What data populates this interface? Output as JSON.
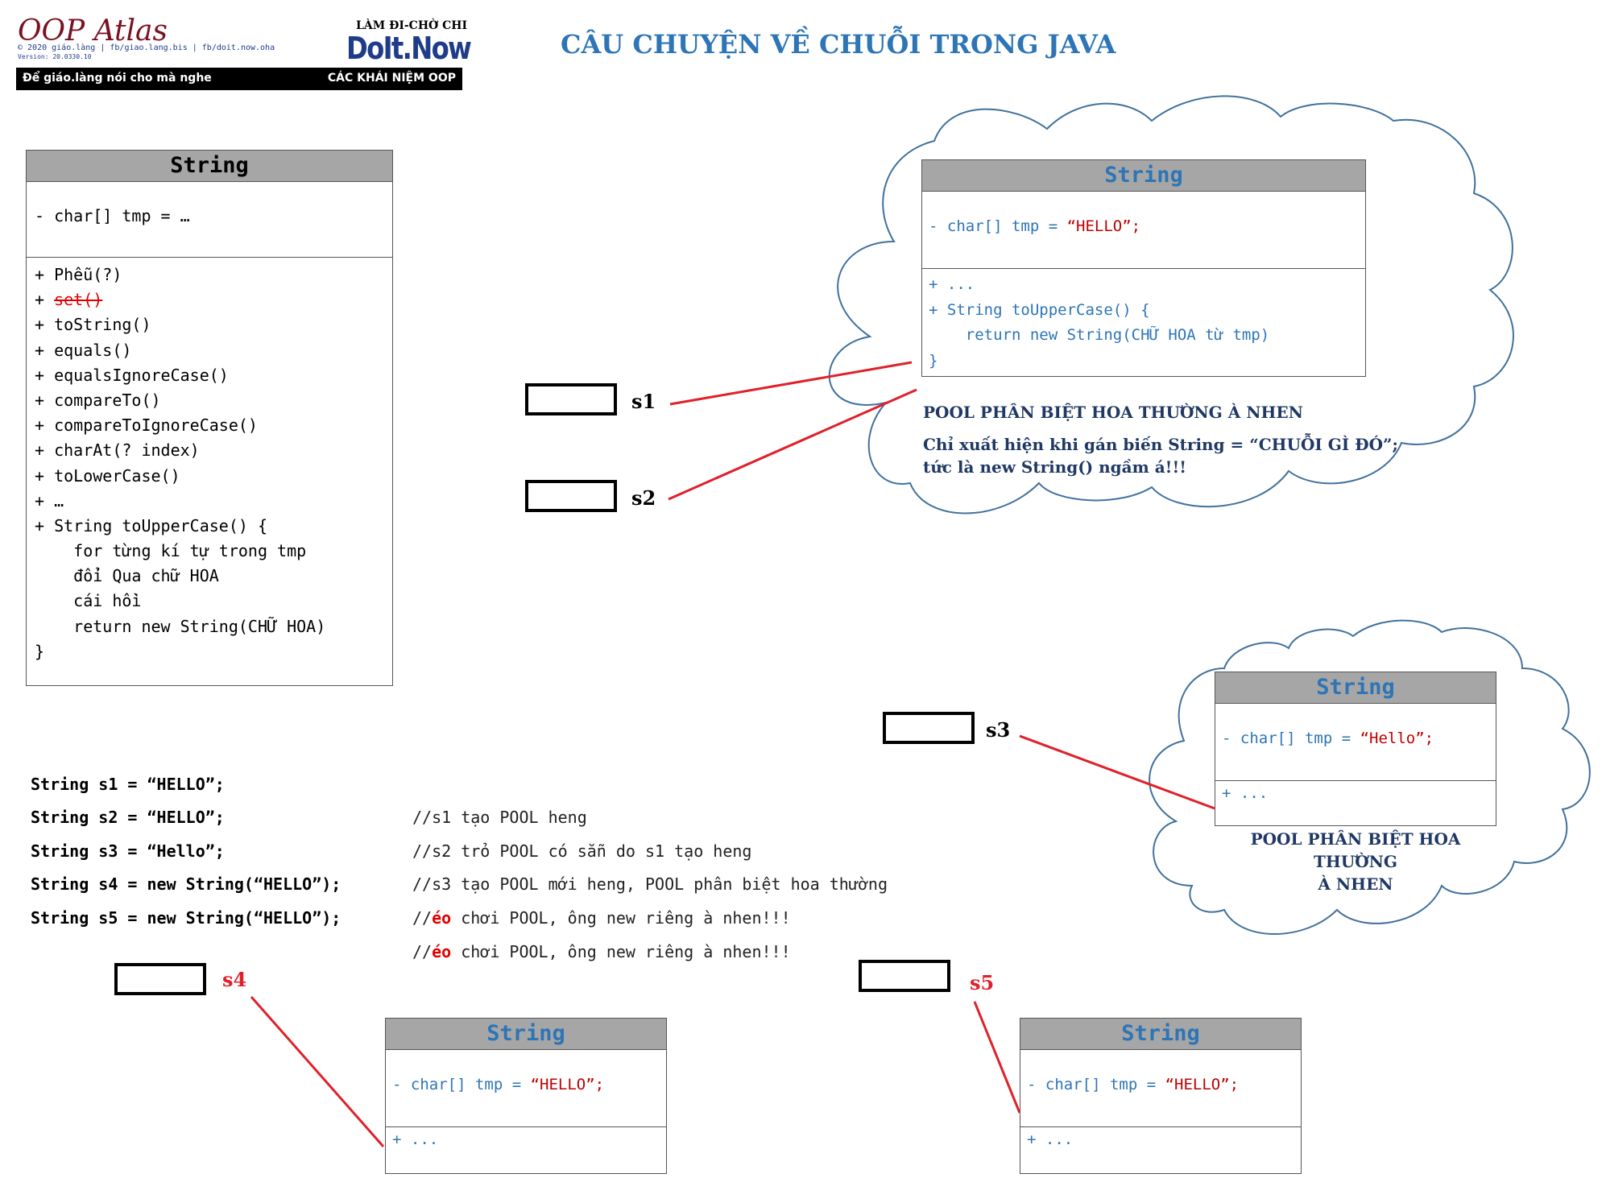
{
  "header": {
    "brand": "OOP Atlas",
    "copyright": "© 2020 giáo.làng | fb/giao.lang.bis | fb/doit.now.oha",
    "version": "Version: 20.0330.10",
    "slogan_top": "LÀM ĐI-CHỜ CHI",
    "logo": "DoIt.Now",
    "bar_left": "Để giáo.làng nói cho mà nghe",
    "bar_right": "CÁC KHÁI NIỆM OOP"
  },
  "title": "CÂU CHUYỆN VỀ CHUỖI TRONG JAVA",
  "string_class": {
    "name": "String",
    "field": "- char[] tmp = …",
    "methods": [
      {
        "text": "+ Phễu(?)",
        "strike": false
      },
      {
        "text": "+ ",
        "strike_text": "set()",
        "strike": true
      },
      {
        "text": "+ toString()",
        "strike": false
      },
      {
        "text": "+ equals()",
        "strike": false
      },
      {
        "text": "+ equalsIgnoreCase()",
        "strike": false
      },
      {
        "text": "+ compareTo()",
        "strike": false
      },
      {
        "text": "+ compareToIgnoreCase()",
        "strike": false
      },
      {
        "text": "+ charAt(? index)",
        "strike": false
      },
      {
        "text": "+ toLowerCase()",
        "strike": false
      },
      {
        "text": "+ …",
        "strike": false
      },
      {
        "text": "+ String toUpperCase() {",
        "strike": false
      },
      {
        "text": "    for từng kí tự trong tmp",
        "strike": false
      },
      {
        "text": "    đổi Qua chữ HOA",
        "strike": false
      },
      {
        "text": "    cái hồi",
        "strike": false
      },
      {
        "text": "    return new String(CHỮ HOA)",
        "strike": false
      },
      {
        "text": "}",
        "strike": false
      }
    ]
  },
  "pool_object_1": {
    "name": "String",
    "field_prefix": "- char[] tmp = ",
    "field_value": "“HELLO”;",
    "lines": [
      "+ ...",
      "+ String toUpperCase() {",
      "    return new String(CHỮ HOA từ tmp)",
      "}"
    ]
  },
  "pool_note_1": {
    "line1": "POOL PHÂN BIỆT HOA THƯỜNG À NHEN",
    "line2": "Chỉ xuất hiện khi gán biến String = “CHUỖI GÌ ĐÓ”;",
    "line3": "tức là new String() ngầm á!!!"
  },
  "pool_object_2": {
    "name": "String",
    "field_prefix": "- char[] tmp = ",
    "field_value": "“Hello”;",
    "line": "+ ..."
  },
  "pool_note_2": {
    "line1": "POOL PHÂN BIỆT HOA THƯỜNG",
    "line2": "À NHEN"
  },
  "heap_object_s4": {
    "name": "String",
    "field_prefix": "- char[] tmp = ",
    "field_value": "“HELLO”;",
    "line": "+ ..."
  },
  "heap_object_s5": {
    "name": "String",
    "field_prefix": "- char[] tmp = ",
    "field_value": "“HELLO”;",
    "line": "+ ..."
  },
  "variables": [
    "s1",
    "s2",
    "s3",
    "s4",
    "s5"
  ],
  "code": [
    {
      "stmt": "String s1 = “HELLO”;",
      "comment": "//s1 tạo POOL heng",
      "comment_red": ""
    },
    {
      "stmt": "String s2 = “HELLO”;",
      "comment": "//s2 trỏ POOL có sẵn do s1 tạo heng",
      "comment_red": ""
    },
    {
      "stmt": "String s3 = “Hello”;",
      "comment": "//s3 tạo POOL mới heng, POOL phân biệt hoa thường",
      "comment_red": ""
    },
    {
      "stmt": "String s4 = new String(“HELLO”);",
      "comment_prefix": "//",
      "comment_red": "éo",
      "comment": " chơi POOL, ông new riêng à nhen!!!"
    },
    {
      "stmt": "String s5 = new String(“HELLO”);",
      "comment_prefix": "//",
      "comment_red": "éo",
      "comment": " chơi POOL, ông new riêng à nhen!!!"
    }
  ],
  "colors": {
    "title_blue": "#2e75b6",
    "value_red": "#c00000",
    "arrow_red": "#e0202a",
    "cloud_stroke": "#41719c",
    "header_gray": "#a6a6a6"
  }
}
